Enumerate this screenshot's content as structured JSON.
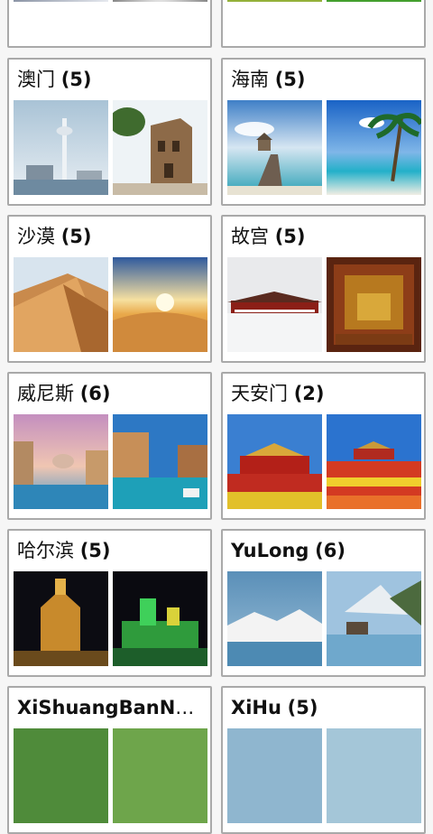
{
  "albums": [
    {
      "name": "",
      "count": ""
    },
    {
      "name": "",
      "count": ""
    },
    {
      "name": "澳门",
      "count": "(5)"
    },
    {
      "name": "海南",
      "count": "(5)"
    },
    {
      "name": "沙漠",
      "count": "(5)"
    },
    {
      "name": "故宫",
      "count": "(5)"
    },
    {
      "name": "威尼斯",
      "count": "(6)"
    },
    {
      "name": "天安门",
      "count": "(2)"
    },
    {
      "name": "哈尔滨",
      "count": "(5)"
    },
    {
      "name": "YuLong",
      "count": "(6)"
    },
    {
      "name": "XiShuangBanNa ...",
      "count": ""
    },
    {
      "name": "XiHu",
      "count": "(5)"
    }
  ],
  "colors": {
    "background": "#f6f6f6",
    "card_border": "#a9a9a9",
    "card_background": "#ffffff"
  }
}
